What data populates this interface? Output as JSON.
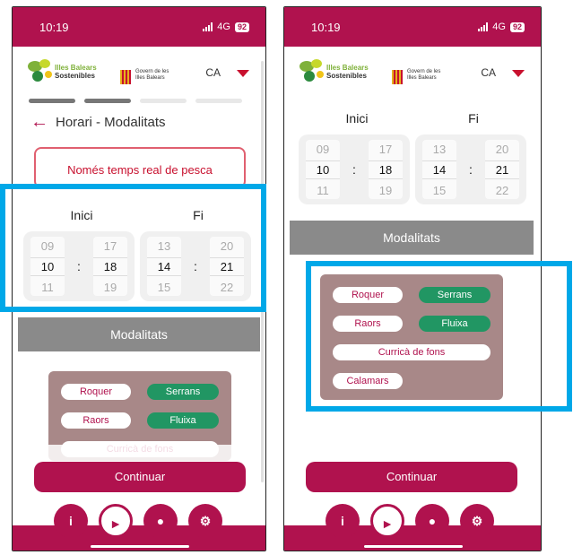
{
  "screens": [
    {
      "status": {
        "time": "10:19",
        "network": "4G",
        "battery": "92"
      },
      "header": {
        "logo_line1": "Illes Balears",
        "logo_line2": "Sostenibles",
        "govern_line1": "Govern de les",
        "govern_line2": "Illes Balears",
        "lang": "CA"
      },
      "title": "Horari - Modalitats",
      "realtime_button": "Només temps real de pesca",
      "start": {
        "label": "Inici",
        "hour_prev": "09",
        "hour": "10",
        "hour_next": "11",
        "min_prev": "17",
        "min": "18",
        "min_next": "19"
      },
      "end": {
        "label": "Fi",
        "hour_prev": "13",
        "hour": "14",
        "hour_next": "15",
        "min_prev": "20",
        "min": "21",
        "min_next": "22"
      },
      "modalities_title": "Modalitats",
      "chips": [
        "Roquer",
        "Serrans",
        "Raors",
        "Fluixa",
        "Curricà de fons"
      ],
      "continue": "Continuar",
      "nav": [
        "info-icon",
        "fish-icon",
        "user-icon",
        "gear-icon"
      ]
    },
    {
      "status": {
        "time": "10:19",
        "network": "4G",
        "battery": "92"
      },
      "header": {
        "logo_line1": "Illes Balears",
        "logo_line2": "Sostenibles",
        "govern_line1": "Govern de les",
        "govern_line2": "Illes Balears",
        "lang": "CA"
      },
      "start": {
        "label": "Inici",
        "hour_prev": "09",
        "hour": "10",
        "hour_next": "11",
        "min_prev": "17",
        "min": "18",
        "min_next": "19"
      },
      "end": {
        "label": "Fi",
        "hour_prev": "13",
        "hour": "14",
        "hour_next": "15",
        "min_prev": "20",
        "min": "21",
        "min_next": "22"
      },
      "modalities_title": "Modalitats",
      "chips": [
        "Roquer",
        "Serrans",
        "Raors",
        "Fluixa",
        "Curricà de fons",
        "Calamars"
      ],
      "continue": "Continuar",
      "nav": [
        "info-icon",
        "fish-icon",
        "user-icon",
        "gear-icon"
      ]
    }
  ],
  "colors": {
    "brand": "#b0124e",
    "highlight": "#00a8e8",
    "chip_green": "#219663",
    "chip_panel": "#a88888"
  }
}
